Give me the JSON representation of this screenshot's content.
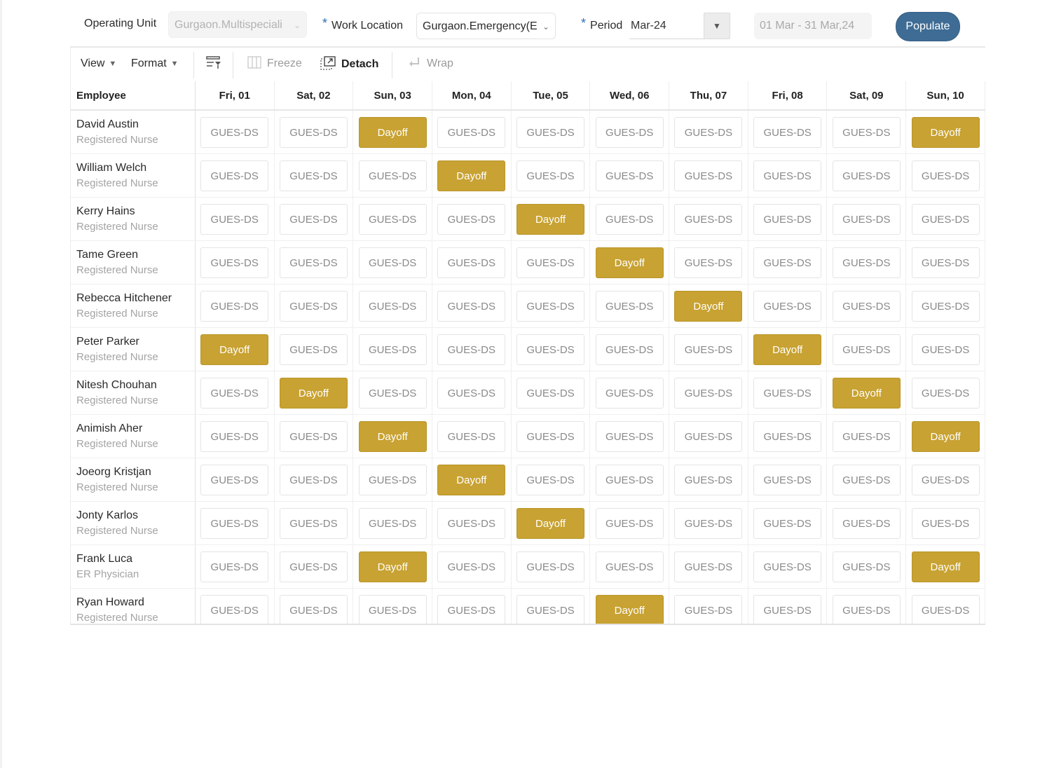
{
  "filters": {
    "operating_unit_label": "Operating Unit",
    "operating_unit_value": "Gurgaon.Multispeciali",
    "work_location_label": "Work Location",
    "work_location_value": "Gurgaon.Emergency(E",
    "period_label": "Period",
    "period_value": "Mar-24",
    "date_range": "01 Mar - 31 Mar,24",
    "populate_label": "Populate",
    "required_mark": "*"
  },
  "toolbar": {
    "view_label": "View",
    "format_label": "Format",
    "freeze_label": "Freeze",
    "detach_label": "Detach",
    "wrap_label": "Wrap"
  },
  "table": {
    "employee_header": "Employee",
    "days": [
      "Fri, 01",
      "Sat, 02",
      "Sun, 03",
      "Mon, 04",
      "Tue, 05",
      "Wed, 06",
      "Thu, 07",
      "Fri, 08",
      "Sat, 09",
      "Sun, 10"
    ],
    "rows": [
      {
        "name": "David Austin",
        "role": "Registered Nurse",
        "cells": [
          "GUES-DS",
          "GUES-DS",
          "Dayoff",
          "GUES-DS",
          "GUES-DS",
          "GUES-DS",
          "GUES-DS",
          "GUES-DS",
          "GUES-DS",
          "Dayoff"
        ]
      },
      {
        "name": "William Welch",
        "role": "Registered Nurse",
        "cells": [
          "GUES-DS",
          "GUES-DS",
          "GUES-DS",
          "Dayoff",
          "GUES-DS",
          "GUES-DS",
          "GUES-DS",
          "GUES-DS",
          "GUES-DS",
          "GUES-DS"
        ]
      },
      {
        "name": "Kerry Hains",
        "role": "Registered Nurse",
        "cells": [
          "GUES-DS",
          "GUES-DS",
          "GUES-DS",
          "GUES-DS",
          "Dayoff",
          "GUES-DS",
          "GUES-DS",
          "GUES-DS",
          "GUES-DS",
          "GUES-DS"
        ]
      },
      {
        "name": "Tame Green",
        "role": "Registered Nurse",
        "cells": [
          "GUES-DS",
          "GUES-DS",
          "GUES-DS",
          "GUES-DS",
          "GUES-DS",
          "Dayoff",
          "GUES-DS",
          "GUES-DS",
          "GUES-DS",
          "GUES-DS"
        ]
      },
      {
        "name": "Rebecca Hitchener",
        "role": "Registered Nurse",
        "cells": [
          "GUES-DS",
          "GUES-DS",
          "GUES-DS",
          "GUES-DS",
          "GUES-DS",
          "GUES-DS",
          "Dayoff",
          "GUES-DS",
          "GUES-DS",
          "GUES-DS"
        ]
      },
      {
        "name": "Peter Parker",
        "role": "Registered Nurse",
        "cells": [
          "Dayoff",
          "GUES-DS",
          "GUES-DS",
          "GUES-DS",
          "GUES-DS",
          "GUES-DS",
          "GUES-DS",
          "Dayoff",
          "GUES-DS",
          "GUES-DS"
        ]
      },
      {
        "name": "Nitesh Chouhan",
        "role": "Registered Nurse",
        "cells": [
          "GUES-DS",
          "Dayoff",
          "GUES-DS",
          "GUES-DS",
          "GUES-DS",
          "GUES-DS",
          "GUES-DS",
          "GUES-DS",
          "Dayoff",
          "GUES-DS"
        ]
      },
      {
        "name": "Animish Aher",
        "role": "Registered Nurse",
        "cells": [
          "GUES-DS",
          "GUES-DS",
          "Dayoff",
          "GUES-DS",
          "GUES-DS",
          "GUES-DS",
          "GUES-DS",
          "GUES-DS",
          "GUES-DS",
          "Dayoff"
        ]
      },
      {
        "name": "Joeorg Kristjan",
        "role": "Registered Nurse",
        "cells": [
          "GUES-DS",
          "GUES-DS",
          "GUES-DS",
          "Dayoff",
          "GUES-DS",
          "GUES-DS",
          "GUES-DS",
          "GUES-DS",
          "GUES-DS",
          "GUES-DS"
        ]
      },
      {
        "name": "Jonty Karlos",
        "role": "Registered Nurse",
        "cells": [
          "GUES-DS",
          "GUES-DS",
          "GUES-DS",
          "GUES-DS",
          "Dayoff",
          "GUES-DS",
          "GUES-DS",
          "GUES-DS",
          "GUES-DS",
          "GUES-DS"
        ]
      },
      {
        "name": "Frank Luca",
        "role": "ER Physician",
        "cells": [
          "GUES-DS",
          "GUES-DS",
          "Dayoff",
          "GUES-DS",
          "GUES-DS",
          "GUES-DS",
          "GUES-DS",
          "GUES-DS",
          "GUES-DS",
          "Dayoff"
        ]
      },
      {
        "name": "Ryan Howard",
        "role": "Registered Nurse",
        "cells": [
          "GUES-DS",
          "GUES-DS",
          "GUES-DS",
          "GUES-DS",
          "GUES-DS",
          "Dayoff",
          "GUES-DS",
          "GUES-DS",
          "GUES-DS",
          "GUES-DS"
        ]
      }
    ]
  },
  "colors": {
    "dayoff_bg": "#c8a232",
    "populate_bg": "#3e6c95",
    "required_mark": "#2f6db5"
  },
  "icons": [
    "chevron-down-icon",
    "caret-down-icon",
    "column-settings-icon",
    "freeze-icon",
    "detach-icon",
    "wrap-icon"
  ]
}
